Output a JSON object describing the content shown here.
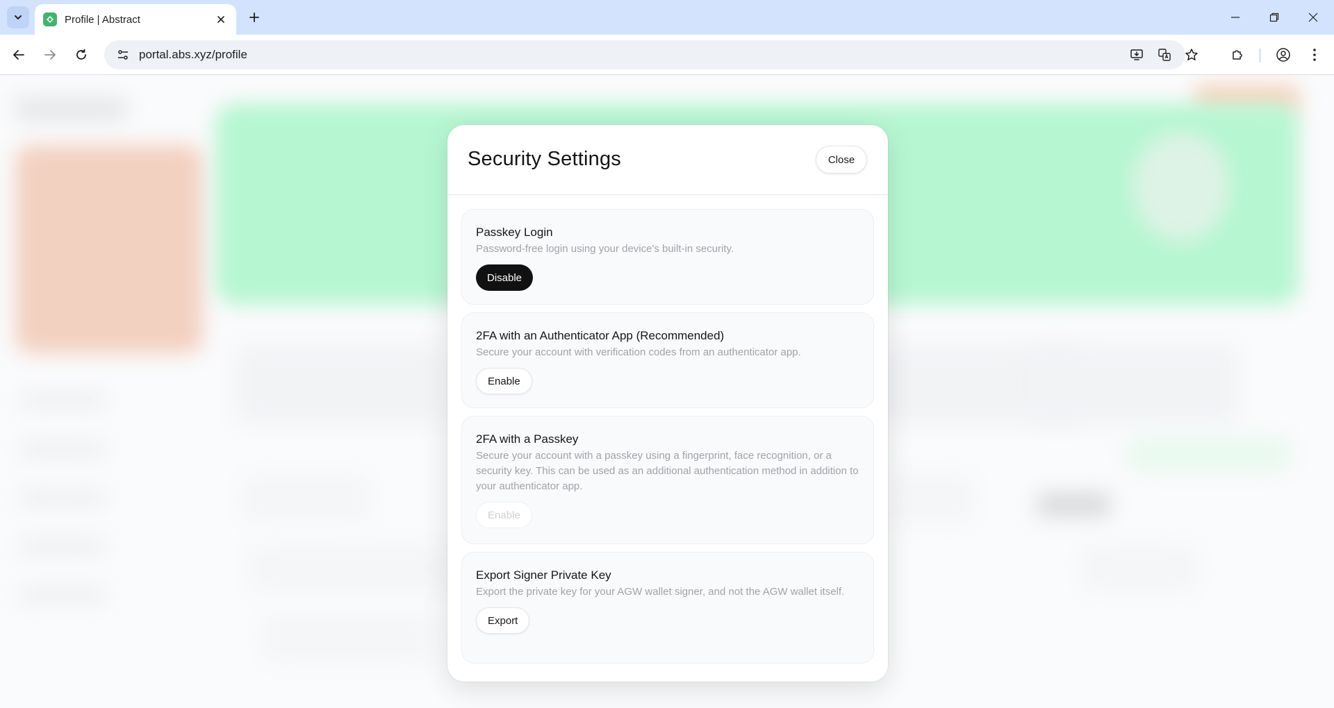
{
  "browser": {
    "tab_title": "Profile | Abstract",
    "url": "portal.abs.xyz/profile"
  },
  "modal": {
    "title": "Security Settings",
    "close_label": "Close",
    "cards": [
      {
        "title": "Passkey Login",
        "description": "Password-free login using your device's built-in security.",
        "button_label": "Disable",
        "button_state": "active-dark"
      },
      {
        "title": "2FA with an Authenticator App (Recommended)",
        "description": "Secure your account with verification codes from an authenticator app.",
        "button_label": "Enable",
        "button_state": "enabled"
      },
      {
        "title": "2FA with a Passkey",
        "description": "Secure your account with a passkey using a fingerprint, face recognition, or a security key. This can be used as an additional authentication method in addition to your authenticator app.",
        "button_label": "Enable",
        "button_state": "disabled"
      },
      {
        "title": "Export Signer Private Key",
        "description": "Export the private key for your AGW wallet signer, and not the AGW wallet itself.",
        "button_label": "Export",
        "button_state": "enabled"
      }
    ]
  },
  "colors": {
    "tabstrip": "#d3e3fd",
    "favicon": "#3fb56b",
    "hero_green": "#7bf0ad",
    "accent_orange": "#e8ab8e",
    "dark_button": "#111111"
  }
}
